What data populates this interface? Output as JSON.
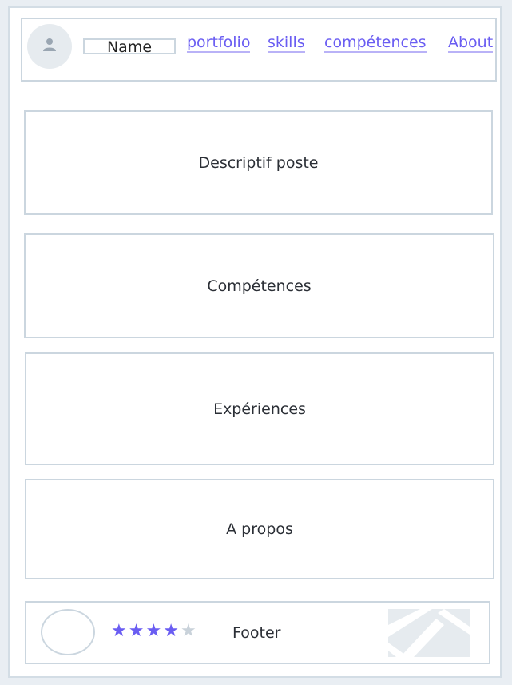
{
  "header": {
    "name": "Name",
    "nav": [
      {
        "label": "portfolio"
      },
      {
        "label": "skills"
      },
      {
        "label": "compétences"
      },
      {
        "label": "About"
      }
    ]
  },
  "sections": [
    {
      "label": "Descriptif poste"
    },
    {
      "label": "Compétences"
    },
    {
      "label": "Expériences"
    },
    {
      "label": "A propos"
    }
  ],
  "footer": {
    "label": "Footer",
    "rating": 4,
    "rating_max": 5
  },
  "colors": {
    "accent": "#6a5df2",
    "border": "#cbd6df",
    "star_filled": "#6a5df2",
    "star_empty": "#c9d2da"
  }
}
